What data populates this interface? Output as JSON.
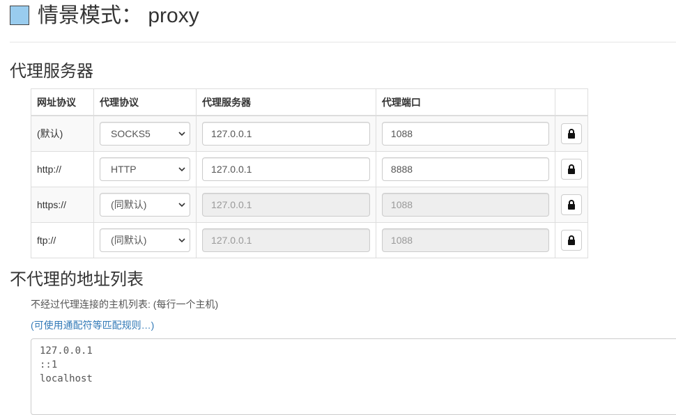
{
  "header": {
    "title": "情景模式： proxy",
    "swatch_color": "#99ccee"
  },
  "proxy_section": {
    "heading": "代理服务器",
    "columns": [
      "网址协议",
      "代理协议",
      "代理服务器",
      "代理端口",
      ""
    ],
    "rows": [
      {
        "scheme": "(默认)",
        "protocol": "SOCKS5",
        "server": "127.0.0.1",
        "port": "1088",
        "disabled": false,
        "lock_icon": "lock-icon"
      },
      {
        "scheme": "http://",
        "protocol": "HTTP",
        "server": "127.0.0.1",
        "port": "8888",
        "disabled": false,
        "lock_icon": "lock-icon"
      },
      {
        "scheme": "https://",
        "protocol": "(同默认)",
        "server": "127.0.0.1",
        "port": "1088",
        "disabled": true,
        "lock_icon": "lock-icon"
      },
      {
        "scheme": "ftp://",
        "protocol": "(同默认)",
        "server": "127.0.0.1",
        "port": "1088",
        "disabled": true,
        "lock_icon": "lock-icon"
      }
    ]
  },
  "bypass_section": {
    "heading": "不代理的地址列表",
    "description": "不经过代理连接的主机列表: (每行一个主机)",
    "wildcard_link": "(可使用通配符等匹配规则…)",
    "entries": [
      "127.0.0.1",
      "::1",
      "localhost"
    ]
  },
  "colors": {
    "link": "#337ab7",
    "disabled_bg": "#eeeeee"
  }
}
